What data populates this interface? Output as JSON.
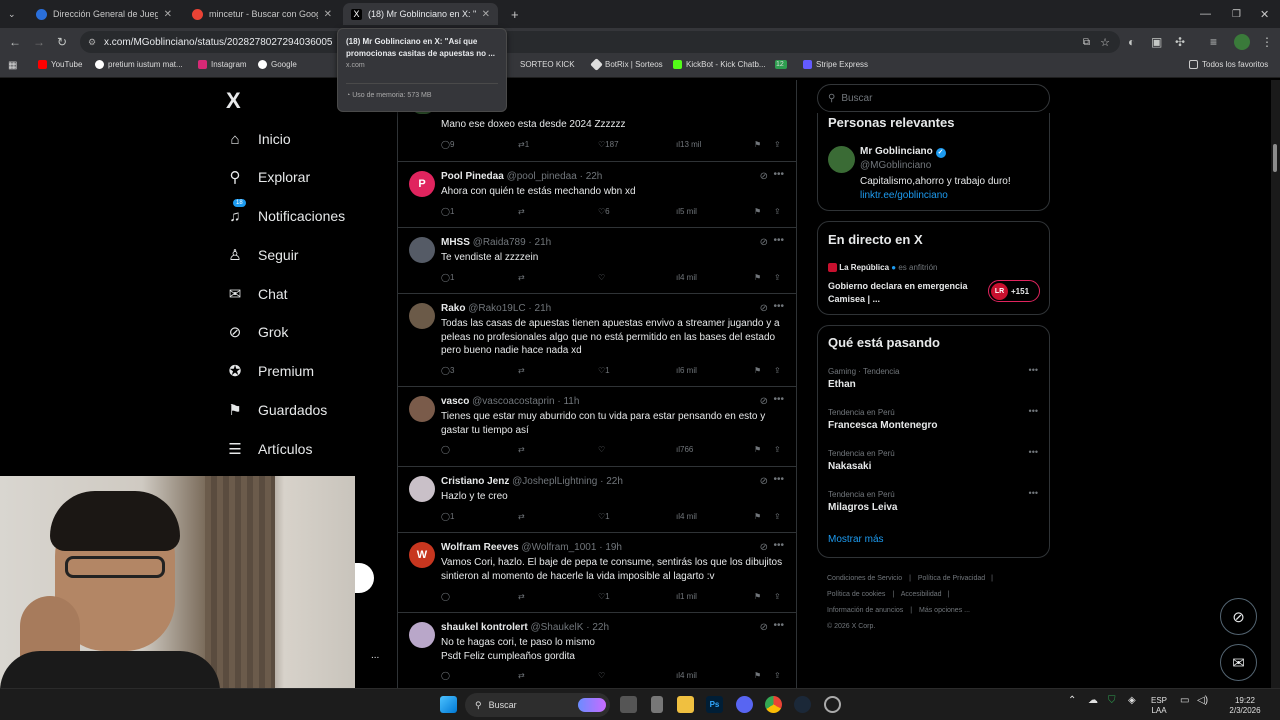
{
  "browser": {
    "tabs": [
      {
        "title": "Dirección General de Juegos de",
        "color": "#2a6fdb"
      },
      {
        "title": "mincetur - Buscar con Google",
        "color": "#ea4335"
      },
      {
        "title": "(18) Mr Goblinciano en X: \"Así",
        "color": "#ffffff"
      }
    ],
    "new_tab": "+",
    "url": "x.com/MGoblinciano/status/2028278027294036005",
    "bookmarks": [
      "YouTube",
      "pretium iustum mat...",
      "Instagram",
      "Google",
      "SORTEO KICK",
      "BotRix | Sorteos",
      "KickBot - Kick Chatb...",
      "12",
      "Stripe Express",
      "Todos los favoritos"
    ],
    "tooltip": {
      "title": "(18) Mr Goblinciano en X: \"Así que promocionas casitas de apuestas no ...",
      "domain": "x.com",
      "memory": "Uso de memoria: 573 MB"
    }
  },
  "nav": {
    "logo": "X",
    "items": [
      {
        "label": "Inicio",
        "icon": "home-icon",
        "glyph": "⌂"
      },
      {
        "label": "Explorar",
        "icon": "search-icon",
        "glyph": "⚲"
      },
      {
        "label": "Notificaciones",
        "icon": "bell-icon",
        "glyph": "♫",
        "badge": "18"
      },
      {
        "label": "Seguir",
        "icon": "follow-icon",
        "glyph": "♙"
      },
      {
        "label": "Chat",
        "icon": "mail-icon",
        "glyph": "✉"
      },
      {
        "label": "Grok",
        "icon": "grok-icon",
        "glyph": "⊘"
      },
      {
        "label": "Premium",
        "icon": "premium-icon",
        "glyph": "✪"
      },
      {
        "label": "Guardados",
        "icon": "bookmark-icon",
        "glyph": "⚑"
      },
      {
        "label": "Artículos",
        "icon": "articles-icon",
        "glyph": "☰"
      }
    ],
    "more": "..."
  },
  "tweets": [
    {
      "name": "",
      "handle": "",
      "time": "",
      "text": "Mano ese doxeo esta desde 2024 Zzzzzz",
      "replies": "9",
      "retweets": "1",
      "likes": "187",
      "views": "13 mil",
      "avatar": "#3d6b3a"
    },
    {
      "name": "Pool Pinedaa",
      "handle": "@pool_pinedaa",
      "time": "22h",
      "text": "Ahora con quién te estás mechando wbn xd",
      "replies": "1",
      "retweets": "",
      "likes": "6",
      "views": "5 mil",
      "avatar": "#e0245e",
      "initial": "P"
    },
    {
      "name": "MHSS",
      "handle": "@Raida789",
      "time": "21h",
      "text": "Te vendiste al zzzzein",
      "replies": "1",
      "retweets": "",
      "likes": "",
      "views": "4 mil",
      "avatar": "#555b66"
    },
    {
      "name": "Rako",
      "handle": "@Rako19LC",
      "time": "21h",
      "text": "Todas las casas de apuestas tienen apuestas envivo a streamer jugando y a peleas no profesionales algo que no está permitido en las bases del estado pero bueno nadie hace nada xd",
      "replies": "3",
      "retweets": "",
      "likes": "1",
      "views": "6 mil",
      "avatar": "#6b5a48"
    },
    {
      "name": "vasco",
      "handle": "@vascoacostaprin",
      "time": "11h",
      "text": "Tienes que estar muy aburrido con tu vida para estar pensando en esto y gastar tu tiempo así",
      "replies": "",
      "retweets": "",
      "likes": "",
      "views": "766",
      "avatar": "#7a5b4a"
    },
    {
      "name": "Cristiano Jenz",
      "handle": "@JosheplLightning",
      "time": "22h",
      "text": "Hazlo y te creo",
      "replies": "1",
      "retweets": "",
      "likes": "1",
      "views": "4 mil",
      "avatar": "#c9c0c8"
    },
    {
      "name": "Wolfram Reeves",
      "handle": "@Wolfram_1001",
      "time": "19h",
      "text": "Vamos Cori, hazlo. El baje de pepa te consume, sentirás los que los dibujitos sintieron al momento de hacerle la vida imposible al lagarto :v",
      "replies": "",
      "retweets": "",
      "likes": "1",
      "views": "1 mil",
      "avatar": "#c7361f",
      "initial": "W"
    },
    {
      "name": "shaukel kontrolert",
      "handle": "@ShaukelK",
      "time": "22h",
      "text": "No te hagas cori, te paso lo mismo\nPsdt Feliz cumpleaños gordita",
      "replies": "",
      "retweets": "",
      "likes": "",
      "views": "4 mil",
      "avatar": "#b9a7c9"
    }
  ],
  "right": {
    "search_placeholder": "Buscar",
    "relevant": {
      "title": "Personas relevantes",
      "name": "Mr Goblinciano",
      "handle": "@MGoblinciano",
      "bio": "Capitalismo,ahorro y trabajo duro!",
      "link": "linktr.ee/goblinciano"
    },
    "live": {
      "title": "En directo en X",
      "host": "La República",
      "host_note": "es anfitrión",
      "headline": "Gobierno declara en emergencia Camisea | ...",
      "count": "+151",
      "logo": "LR"
    },
    "trends": {
      "title": "Qué está pasando",
      "items": [
        {
          "context": "Gaming · Tendencia",
          "name": "Ethan"
        },
        {
          "context": "Tendencia en Perú",
          "name": "Francesca Montenegro"
        },
        {
          "context": "Tendencia en Perú",
          "name": "Nakasaki"
        },
        {
          "context": "Tendencia en Perú",
          "name": "Milagros Leiva"
        }
      ],
      "more": "Mostrar más"
    },
    "footer": [
      "Condiciones de Servicio",
      "Política de Privacidad",
      "Política de cookies",
      "Accesibilidad",
      "Información de anuncios",
      "Más opciones ...",
      "© 2026 X Corp."
    ]
  },
  "taskbar": {
    "search": "Buscar",
    "lang1": "ESP",
    "lang2": "LAA",
    "time": "19:22",
    "date": "2/3/2026"
  },
  "colors": {
    "accent": "#1d9bf0",
    "bg": "#000000",
    "border": "#2f3336",
    "muted": "#71767b"
  }
}
